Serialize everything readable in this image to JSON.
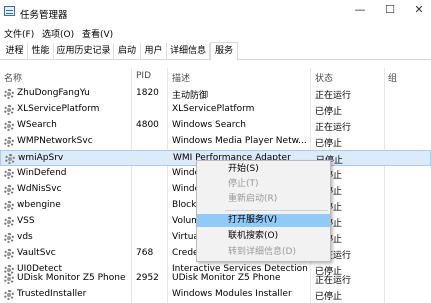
{
  "window": {
    "title": "任务管理器",
    "minimize": "—",
    "maximize": "☐",
    "close": "✕"
  },
  "menu": [
    "文件(F)",
    "选项(O)",
    "查看(V)"
  ],
  "tabs": [
    "进程",
    "性能",
    "应用历史记录",
    "启动",
    "用户",
    "详细信息",
    "服务"
  ],
  "active_tab": "服务",
  "columns": {
    "name": "名称",
    "pid": "PID",
    "desc": "描述",
    "status": "状态",
    "group": "组"
  },
  "services": [
    {
      "name": "ZhuDongFangYu",
      "pid": "1820",
      "desc": "主动防御",
      "status": "正在运行"
    },
    {
      "name": "XLServicePlatform",
      "pid": "",
      "desc": "XLServicePlatform",
      "status": "已停止"
    },
    {
      "name": "WSearch",
      "pid": "4800",
      "desc": "Windows Search",
      "status": "正在运行"
    },
    {
      "name": "WMPNetworkSvc",
      "pid": "",
      "desc": "Windows Media Player Netw...",
      "status": "已停止"
    },
    {
      "name": "wmiApSrv",
      "pid": "",
      "desc": "WMI Performance Adapter",
      "status": "已停止"
    },
    {
      "name": "WinDefend",
      "pid": "",
      "desc": "Windo",
      "status": "已停止"
    },
    {
      "name": "WdNisSvc",
      "pid": "",
      "desc": "Windo",
      "status": "已停止"
    },
    {
      "name": "wbengine",
      "pid": "",
      "desc": "Block l",
      "status": "已停止"
    },
    {
      "name": "VSS",
      "pid": "",
      "desc": "Volume",
      "status": "已停止"
    },
    {
      "name": "vds",
      "pid": "",
      "desc": "Virtual",
      "status": "已停止"
    },
    {
      "name": "VaultSvc",
      "pid": "768",
      "desc": "Creden",
      "status": "正在运行"
    },
    {
      "name": "UI0Detect",
      "pid": "",
      "desc": "Interactive Services Detection",
      "status": "已停止"
    },
    {
      "name": "UDisk Monitor Z5 Phone",
      "pid": "2952",
      "desc": "UDisk Monitor Z5 Phone",
      "status": "正在运行"
    },
    {
      "name": "TrustedInstaller",
      "pid": "",
      "desc": "Windows Modules Installer",
      "status": "已停止"
    }
  ],
  "context_menu": {
    "start": "开始(S)",
    "stop": "停止(T)",
    "restart": "重新启动(R)",
    "open_services": "打开服务(V)",
    "search_online": "联机搜索(O)",
    "go_to_details": "转到详细信息(D)"
  }
}
